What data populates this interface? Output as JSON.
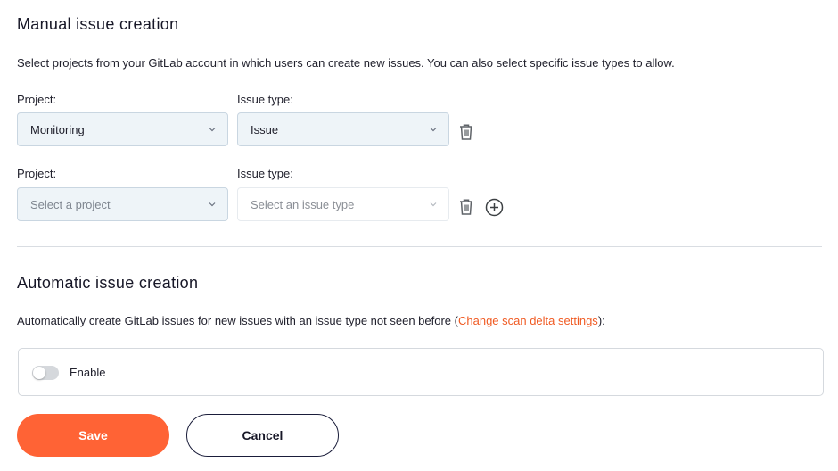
{
  "manual": {
    "title": "Manual issue creation",
    "description": "Select projects from your GitLab account in which users can create new issues. You can also select specific issue types to allow.",
    "rows": [
      {
        "project_label": "Project:",
        "issue_type_label": "Issue type:",
        "project_value": "Monitoring",
        "issue_type_value": "Issue"
      },
      {
        "project_label": "Project:",
        "issue_type_label": "Issue type:",
        "project_placeholder": "Select a project",
        "issue_type_placeholder": "Select an issue type"
      }
    ]
  },
  "automatic": {
    "title": "Automatic issue creation",
    "description_prefix": "Automatically create GitLab issues for new issues with an issue type not seen before  (",
    "description_link": "Change scan delta settings",
    "description_suffix": "):",
    "toggle_label": "Enable",
    "toggle_on": false
  },
  "actions": {
    "save_label": "Save",
    "cancel_label": "Cancel"
  },
  "colors": {
    "accent": "#ff6335",
    "link": "#f05a22"
  }
}
